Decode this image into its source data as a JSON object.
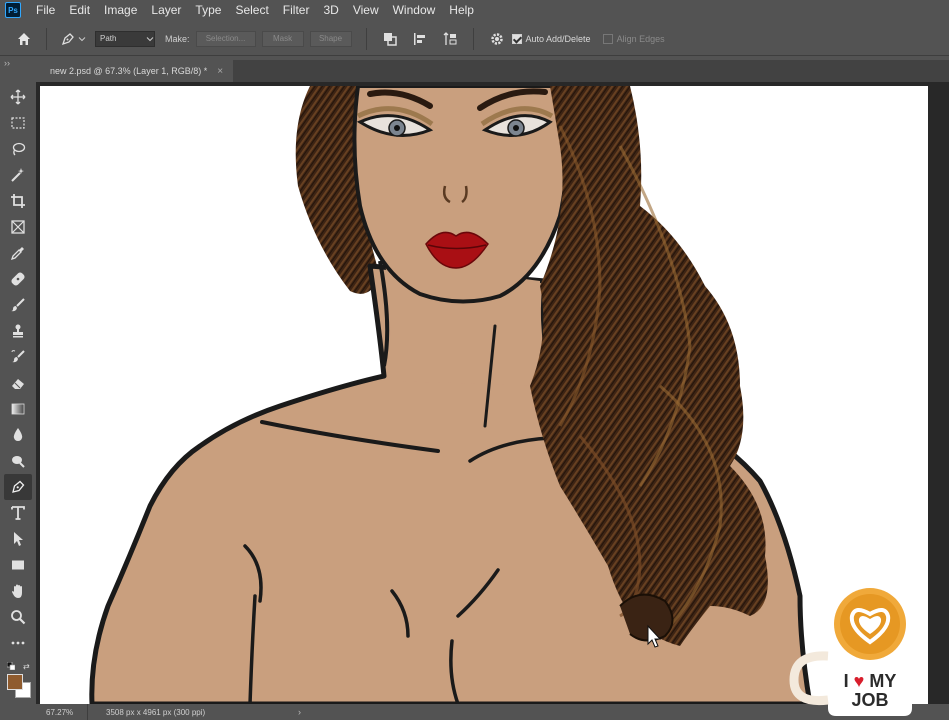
{
  "app": {
    "logo": "Ps"
  },
  "menu": [
    "File",
    "Edit",
    "Image",
    "Layer",
    "Type",
    "Select",
    "Filter",
    "3D",
    "View",
    "Window",
    "Help"
  ],
  "options_bar": {
    "mode_value": "Path",
    "make_label": "Make:",
    "selection_btn": "Selection...",
    "mask_btn": "Mask",
    "shape_btn": "Shape",
    "auto_add_delete": "Auto Add/Delete",
    "align_edges": "Align Edges"
  },
  "document": {
    "tab_title": "new 2.psd @ 67.3% (Layer 1, RGB/8) *",
    "close": "×"
  },
  "tools": [
    "move-icon",
    "marquee-icon",
    "lasso-icon",
    "magic-wand-icon",
    "crop-icon",
    "frame-icon",
    "eyedropper-icon",
    "healing-brush-icon",
    "brush-icon",
    "clone-stamp-icon",
    "history-brush-icon",
    "eraser-icon",
    "gradient-icon",
    "blur-icon",
    "dodge-icon",
    "pen-icon",
    "type-icon",
    "path-selection-icon",
    "rectangle-icon",
    "hand-icon",
    "zoom-icon",
    "more-tools-icon"
  ],
  "colors": {
    "foreground": "#8f5b2e",
    "background": "#ffffff",
    "skin": "#c99f7e",
    "hair": "#3b2414",
    "lips": "#a90f14"
  },
  "status": {
    "zoom": "67.27%",
    "doc_info": "3508 px x 4961 px (300 ppi)",
    "arrow": "›"
  },
  "watermark": {
    "line1_a": "I",
    "heart": "♥",
    "line1_b": "MY",
    "line2": "JOB"
  }
}
